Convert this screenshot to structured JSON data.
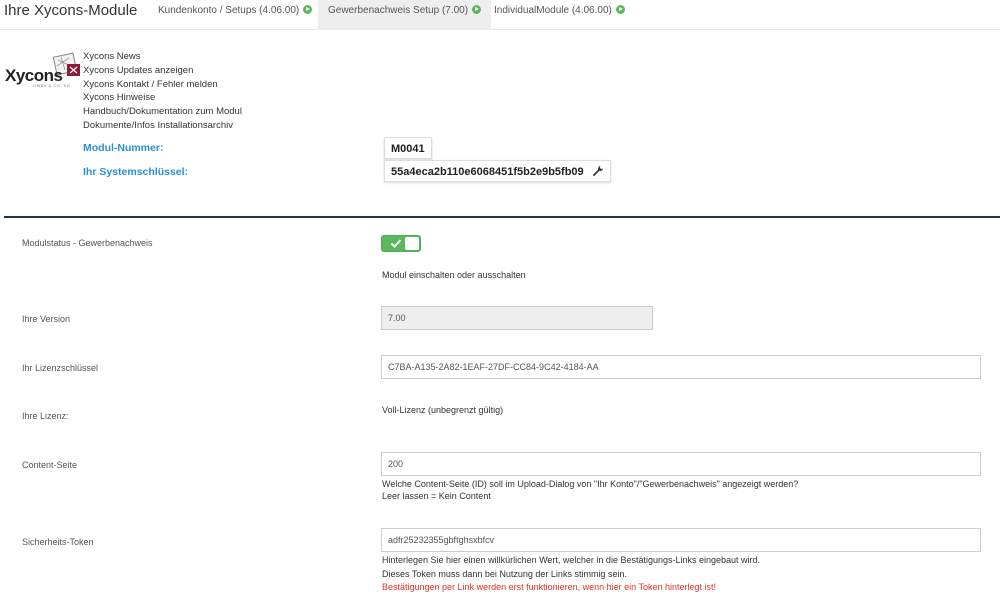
{
  "header": {
    "title": "Ihre Xycons-Module",
    "tabs": [
      {
        "label": "Kundenkonto / Setups (4.06.00)",
        "active": false
      },
      {
        "label": "Gewerbenachweis Setup (7.00)",
        "active": true
      },
      {
        "label": "IndividualModule (4.06.00)",
        "active": false
      }
    ]
  },
  "logo": {
    "text": "Xycons",
    "sub": "GMBH & CO. KG"
  },
  "links": [
    "Xycons News",
    "Xycons Updates anzeigen",
    "Xycons Kontakt / Fehler melden",
    "Xycons Hinweise",
    "Handbuch/Dokumentation zum Modul",
    "Dokumente/Infos Installationsarchiv"
  ],
  "module": {
    "number_label": "Modul-Nummer:",
    "number_value": "M0041",
    "key_label": "Ihr Systemschlüssel:",
    "key_value": "55a4eca2b110e6068451f5b2e9b5fb09"
  },
  "form": {
    "status": {
      "label": "Modulstatus - Gewerbenachweis",
      "enabled": true,
      "help": "Modul einschalten oder ausschalten"
    },
    "version": {
      "label": "Ihre Version",
      "value": "7.00"
    },
    "license_key": {
      "label": "Ihr Lizenzschlüssel",
      "value": "C7BA-A135-2A82-1EAF-27DF-CC84-9C42-4184-AA"
    },
    "license": {
      "label": "Ihre Lizenz:",
      "value": "Voll-Lizenz (unbegrenzt gültig)"
    },
    "content_page": {
      "label": "Content-Seite",
      "value": "200",
      "help1": "Welche Content-Seite (ID) soll im Upload-Dialog von \"Ihr Konto\"/\"Gewerbenachweis\" angezeigt werden?",
      "help2": "Leer lassen = Kein Content"
    },
    "token": {
      "label": "Sicherheits-Token",
      "value": "adfr25232355gbftghsxbfcv",
      "help1": "Hinterlegen Sie hier einen willkürlichen Wert, welcher in die Bestätigungs-Links eingebaut wird.",
      "help2": "Dieses Token muss dann bei Nutzung der Links stimmig sein.",
      "warning": "Bestätigungen per Link werden erst funktionieren, wenn hier ein Token hinterlegt ist!"
    }
  },
  "colors": {
    "accent": "#2a8fd6",
    "toggle": "#5cb85c",
    "warning": "#e0312b",
    "separator": "#1f3448"
  },
  "icons": {
    "tab_status": "play-circle-icon",
    "wrench": "wrench-icon",
    "toggle_check": "check-icon"
  }
}
